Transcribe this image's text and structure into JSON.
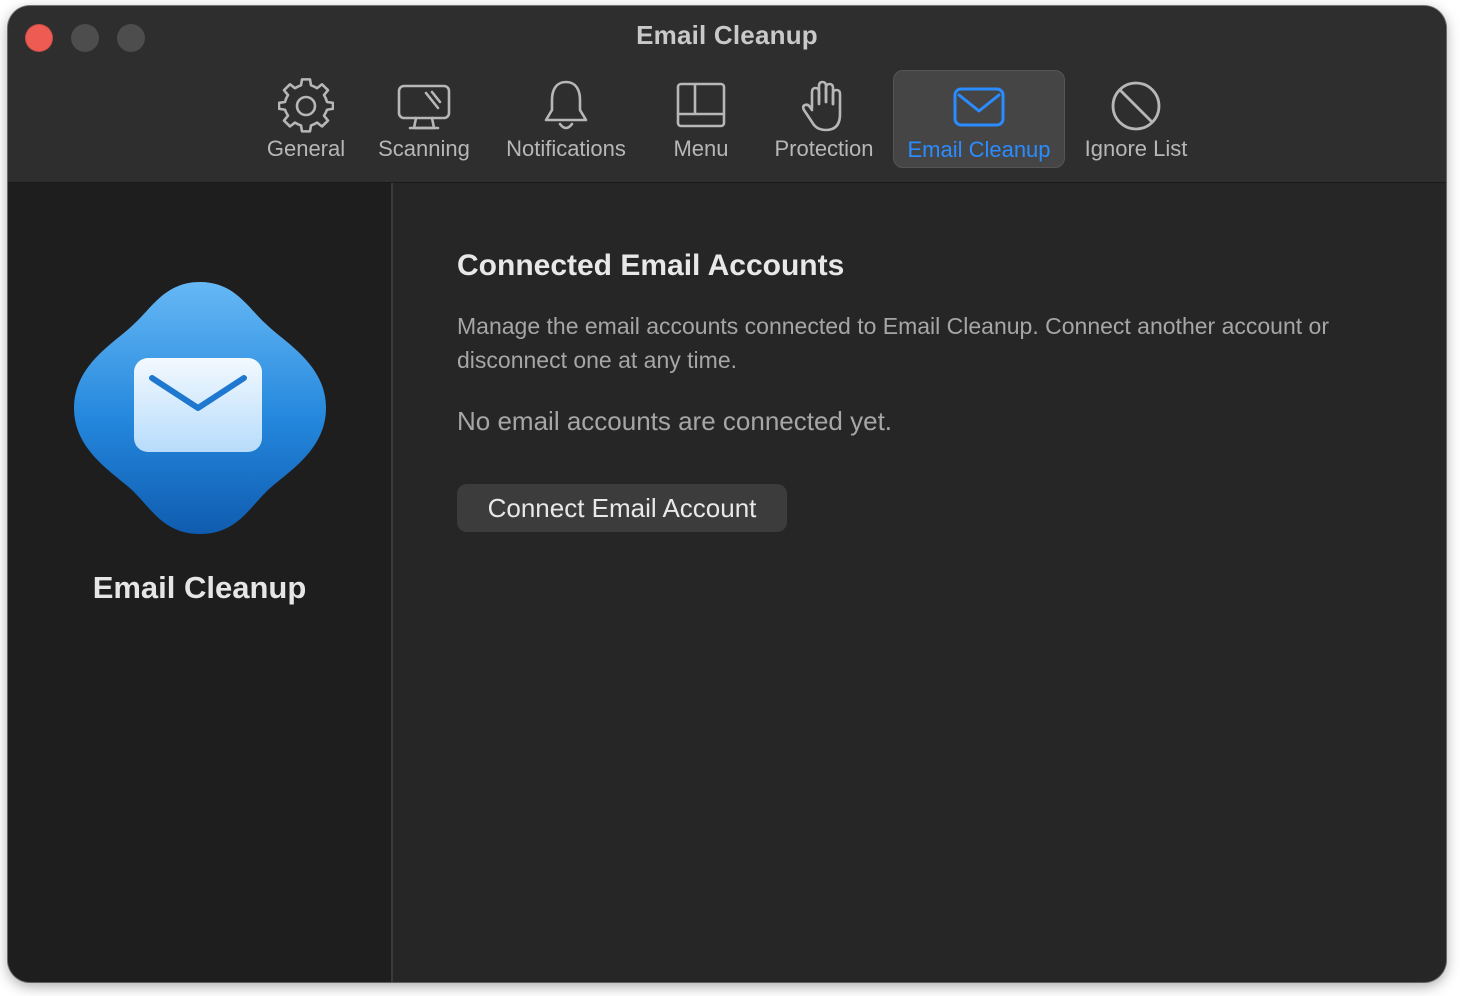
{
  "window": {
    "title": "Email Cleanup"
  },
  "toolbar": {
    "tabs": [
      {
        "label": "General",
        "icon": "gear-icon"
      },
      {
        "label": "Scanning",
        "icon": "display-scan-icon"
      },
      {
        "label": "Notifications",
        "icon": "bell-icon"
      },
      {
        "label": "Menu",
        "icon": "menu-layout-icon"
      },
      {
        "label": "Protection",
        "icon": "hand-raised-icon"
      },
      {
        "label": "Email Cleanup",
        "icon": "envelope-icon",
        "active": true
      },
      {
        "label": "Ignore List",
        "icon": "prohibited-icon"
      }
    ]
  },
  "sidebar": {
    "app_name": "Email Cleanup",
    "logo_icon": "envelope-app-icon"
  },
  "main": {
    "section_title": "Connected Email Accounts",
    "description": "Manage the email accounts connected to Email Cleanup. Connect another account or disconnect one at any time.",
    "empty_state": "No email accounts are connected yet.",
    "connect_button_label": "Connect Email Account"
  },
  "colors": {
    "accent": "#2b8cff",
    "close_button": "#ee5b53",
    "window_background": "#262626",
    "sidebar_background": "#1e1e1e"
  }
}
